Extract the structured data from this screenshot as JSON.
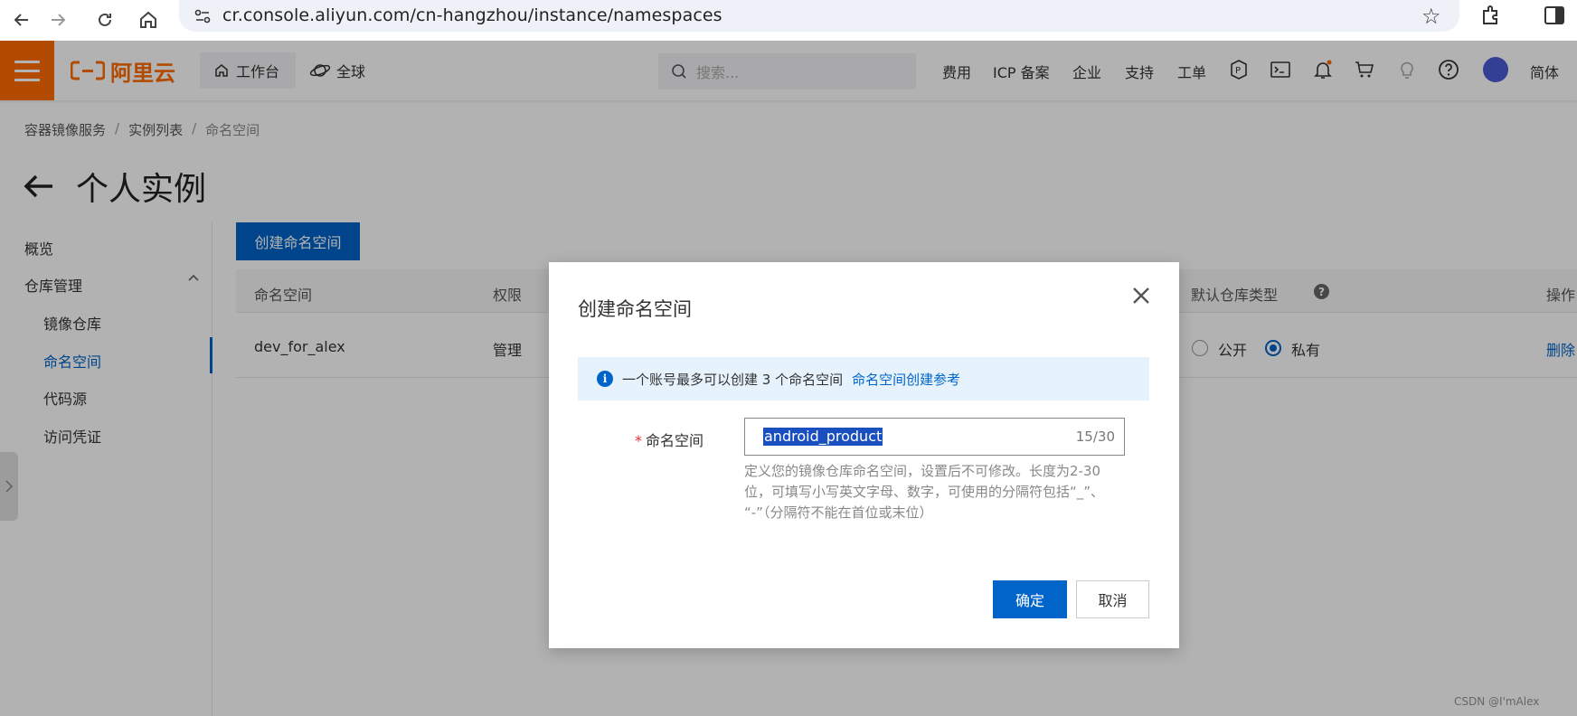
{
  "browser": {
    "url": "cr.console.aliyun.com/cn-hangzhou/instance/namespaces"
  },
  "header": {
    "logo_text": "阿里云",
    "workbench": "工作台",
    "global": "全球",
    "search_placeholder": "搜索...",
    "links": [
      "费用",
      "ICP 备案",
      "企业",
      "支持",
      "工单"
    ],
    "lang": "简体",
    "brand_color": "#ff6a00"
  },
  "breadcrumb": [
    "容器镜像服务",
    "实例列表",
    "命名空间"
  ],
  "page_title": "个人实例",
  "sidebar": {
    "items": [
      {
        "label": "概览"
      },
      {
        "label": "仓库管理"
      },
      {
        "label": "镜像仓库"
      },
      {
        "label": "命名空间"
      },
      {
        "label": "代码源"
      },
      {
        "label": "访问凭证"
      }
    ],
    "active": "命名空间"
  },
  "main": {
    "create_button": "创建命名空间",
    "columns": [
      "命名空间",
      "权限",
      "默认仓库类型",
      "操作"
    ],
    "rows": [
      {
        "namespace": "dev_for_alex",
        "permission": "管理",
        "public_label": "公开",
        "private_label": "私有",
        "selected": "私有",
        "action": "删除"
      }
    ]
  },
  "dialog": {
    "title": "创建命名空间",
    "info_text": "一个账号最多可以创建 3 个命名空间",
    "info_link": "命名空间创建参考",
    "field_label": "命名空间",
    "field_value": "android_product",
    "field_count": "15/30",
    "help_line1": "定义您的镜像仓库命名空间，设置后不可修改。长度为2-30",
    "help_line2": "位，可填写小写英文字母、数字，可使用的分隔符包括“_”、",
    "help_line3": "“-”（分隔符不能在首位或末位）",
    "ok": "确定",
    "cancel": "取消",
    "accent_color": "#0064c8"
  },
  "watermark": "CSDN @I'mAlex"
}
